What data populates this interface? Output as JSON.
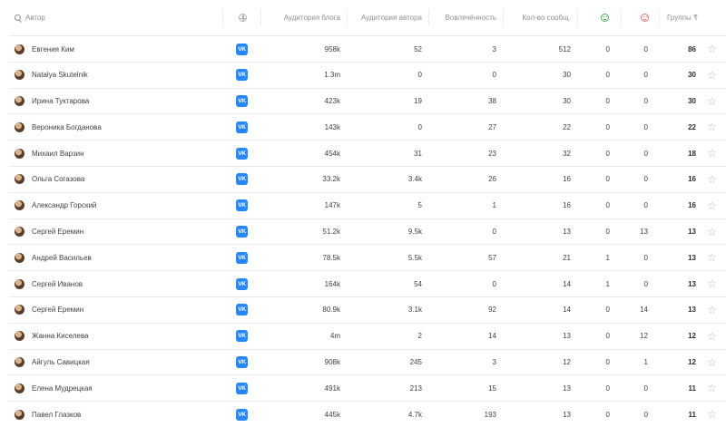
{
  "header": {
    "author": "Автор",
    "blog_audience": "Аудитория блога",
    "author_audience": "Аудитория автора",
    "engagement": "Вовлечённость",
    "messages_count": "Кол-во сообщ.",
    "groups": "Группы ₹"
  },
  "rows": [
    {
      "name": "Евгения Ким",
      "blog": "958k",
      "auth": "52",
      "eng": "3",
      "msgs": "512",
      "pos": "0",
      "neg": "0",
      "groups": "86"
    },
    {
      "name": "Natalya Skutelnik",
      "blog": "1.3m",
      "auth": "0",
      "eng": "0",
      "msgs": "30",
      "pos": "0",
      "neg": "0",
      "groups": "30"
    },
    {
      "name": "Ирина Туктарова",
      "blog": "423k",
      "auth": "19",
      "eng": "38",
      "msgs": "30",
      "pos": "0",
      "neg": "0",
      "groups": "30"
    },
    {
      "name": "Вероника Богданова",
      "blog": "143k",
      "auth": "0",
      "eng": "27",
      "msgs": "22",
      "pos": "0",
      "neg": "0",
      "groups": "22"
    },
    {
      "name": "Михаил Варзин",
      "blog": "454k",
      "auth": "31",
      "eng": "23",
      "msgs": "32",
      "pos": "0",
      "neg": "0",
      "groups": "18"
    },
    {
      "name": "Ольга Согазова",
      "blog": "33.2k",
      "auth": "3.4k",
      "eng": "26",
      "msgs": "16",
      "pos": "0",
      "neg": "0",
      "groups": "16"
    },
    {
      "name": "Александр Горский",
      "blog": "147k",
      "auth": "5",
      "eng": "1",
      "msgs": "16",
      "pos": "0",
      "neg": "0",
      "groups": "16"
    },
    {
      "name": "Сергей Еремин",
      "blog": "51.2k",
      "auth": "9.5k",
      "eng": "0",
      "msgs": "13",
      "pos": "0",
      "neg": "13",
      "groups": "13"
    },
    {
      "name": "Андрей Васильев",
      "blog": "78.5k",
      "auth": "5.5k",
      "eng": "57",
      "msgs": "21",
      "pos": "1",
      "neg": "0",
      "groups": "13"
    },
    {
      "name": "Сергей Иванов",
      "blog": "164k",
      "auth": "54",
      "eng": "0",
      "msgs": "14",
      "pos": "1",
      "neg": "0",
      "groups": "13"
    },
    {
      "name": "Сергей Еремин",
      "blog": "80.9k",
      "auth": "3.1k",
      "eng": "92",
      "msgs": "14",
      "pos": "0",
      "neg": "14",
      "groups": "13"
    },
    {
      "name": "Жанна Киселева",
      "blog": "4m",
      "auth": "2",
      "eng": "14",
      "msgs": "13",
      "pos": "0",
      "neg": "12",
      "groups": "12"
    },
    {
      "name": "Айгуль Савицкая",
      "blog": "908k",
      "auth": "245",
      "eng": "3",
      "msgs": "12",
      "pos": "0",
      "neg": "1",
      "groups": "12"
    },
    {
      "name": "Елена Мудрецкая",
      "blog": "491k",
      "auth": "213",
      "eng": "15",
      "msgs": "13",
      "pos": "0",
      "neg": "0",
      "groups": "11"
    },
    {
      "name": "Павел Глазков",
      "blog": "445k",
      "auth": "4.7k",
      "eng": "193",
      "msgs": "13",
      "pos": "0",
      "neg": "0",
      "groups": "11"
    }
  ],
  "icons": {
    "network": "vk-icon",
    "favorite": "star-icon",
    "positive": "smile-positive-icon",
    "negative": "smile-negative-icon",
    "platform": "globe-icon",
    "search": "search-icon"
  },
  "colors": {
    "vk_blue": "#2787f5",
    "positive": "#4caf50",
    "negative": "#e57373",
    "muted_text": "#8c8f96",
    "divider": "#e8eaed"
  }
}
